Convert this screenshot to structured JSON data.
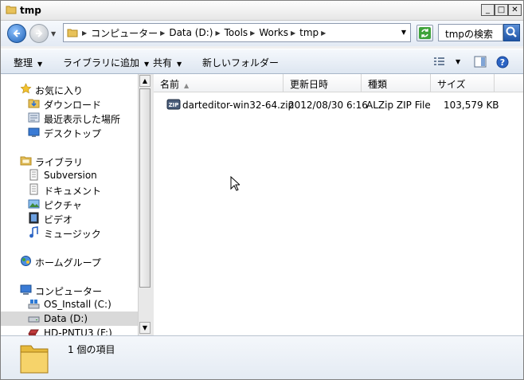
{
  "window": {
    "title": "tmp"
  },
  "address": {
    "breadcrumbs": [
      "コンピューター",
      "Data (D:)",
      "Tools",
      "Works",
      "tmp"
    ],
    "search_placeholder": "tmpの検索"
  },
  "toolbar": {
    "organize": "整理",
    "include_library": "ライブラリに追加",
    "share": "共有",
    "new_folder": "新しいフォルダー"
  },
  "nav": {
    "favorites": {
      "label": "お気に入り",
      "items": [
        "ダウンロード",
        "最近表示した場所",
        "デスクトップ"
      ]
    },
    "libraries": {
      "label": "ライブラリ",
      "items": [
        "Subversion",
        "ドキュメント",
        "ピクチャ",
        "ビデオ",
        "ミュージック"
      ]
    },
    "homegroup": {
      "label": "ホームグループ"
    },
    "computer": {
      "label": "コンピューター",
      "items": [
        "OS_Install (C:)",
        "Data (D:)",
        "HD-PNTU3 (F:)"
      ]
    }
  },
  "columns": {
    "name": "名前",
    "modified": "更新日時",
    "type": "種類",
    "size": "サイズ"
  },
  "files": [
    {
      "name": "darteditor-win32-64.zip",
      "modified": "2012/08/30 6:16",
      "type": "ALZip ZIP File",
      "size": "103,579 KB"
    }
  ],
  "status": {
    "item_count": "1 個の項目"
  },
  "selected_drive": "Data (D:)"
}
